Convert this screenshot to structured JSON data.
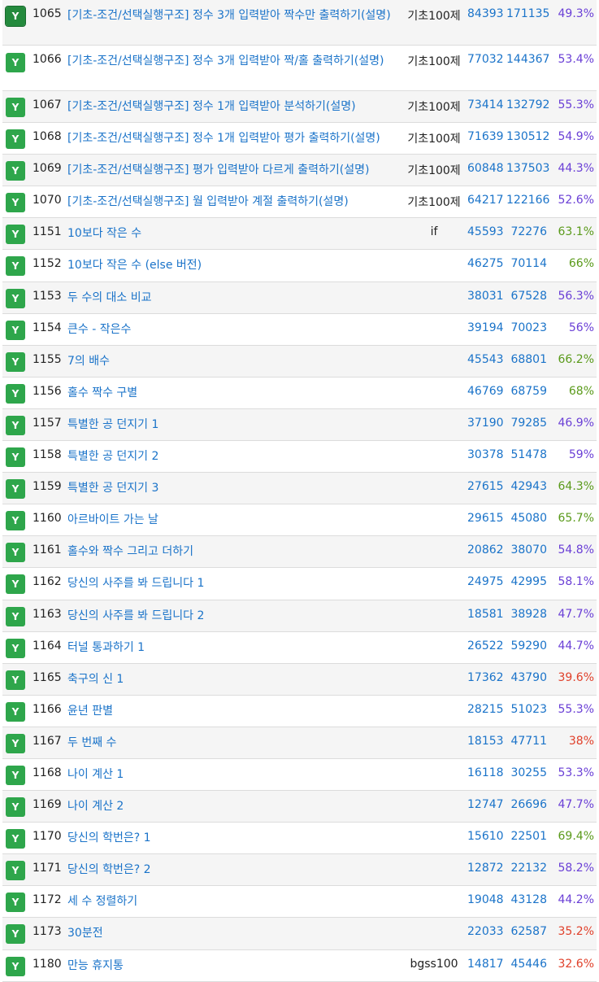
{
  "colors": {
    "badge": "#2ea64b",
    "link": "#1a73c9",
    "rate_purple": "#6a3fd6",
    "rate_green": "#5a9a1a",
    "rate_red": "#e0402a"
  },
  "badge_text": "Y",
  "rows": [
    {
      "id": "1065",
      "title": "[기초-조건/선택실행구조] 정수 3개 입력받아 짝수만 출력하기(설명)",
      "category": "기초100제",
      "solved": "84393",
      "submissions": "171135",
      "rate": "49.3%",
      "rate_color": "purple",
      "tall": true
    },
    {
      "id": "1066",
      "title": "[기초-조건/선택실행구조] 정수 3개 입력받아 짝/홀 출력하기(설명)",
      "category": "기초100제",
      "solved": "77032",
      "submissions": "144367",
      "rate": "53.4%",
      "rate_color": "purple",
      "tall": true
    },
    {
      "id": "1067",
      "title": "[기초-조건/선택실행구조] 정수 1개 입력받아 분석하기(설명)",
      "category": "기초100제",
      "solved": "73414",
      "submissions": "132792",
      "rate": "55.3%",
      "rate_color": "purple",
      "tall": false
    },
    {
      "id": "1068",
      "title": "[기초-조건/선택실행구조] 정수 1개 입력받아 평가 출력하기(설명)",
      "category": "기초100제",
      "solved": "71639",
      "submissions": "130512",
      "rate": "54.9%",
      "rate_color": "purple",
      "tall": false
    },
    {
      "id": "1069",
      "title": "[기초-조건/선택실행구조] 평가 입력받아 다르게 출력하기(설명)",
      "category": "기초100제",
      "solved": "60848",
      "submissions": "137503",
      "rate": "44.3%",
      "rate_color": "purple",
      "tall": false
    },
    {
      "id": "1070",
      "title": "[기초-조건/선택실행구조] 월 입력받아 계절 출력하기(설명)",
      "category": "기초100제",
      "solved": "64217",
      "submissions": "122166",
      "rate": "52.6%",
      "rate_color": "purple",
      "tall": false
    },
    {
      "id": "1151",
      "title": "10보다 작은 수",
      "category": "if",
      "solved": "45593",
      "submissions": "72276",
      "rate": "63.1%",
      "rate_color": "green",
      "tall": false
    },
    {
      "id": "1152",
      "title": "10보다 작은 수 (else 버전)",
      "category": "",
      "solved": "46275",
      "submissions": "70114",
      "rate": "66%",
      "rate_color": "green",
      "tall": false
    },
    {
      "id": "1153",
      "title": "두 수의 대소 비교",
      "category": "",
      "solved": "38031",
      "submissions": "67528",
      "rate": "56.3%",
      "rate_color": "purple",
      "tall": false
    },
    {
      "id": "1154",
      "title": "큰수 - 작은수",
      "category": "",
      "solved": "39194",
      "submissions": "70023",
      "rate": "56%",
      "rate_color": "purple",
      "tall": false
    },
    {
      "id": "1155",
      "title": "7의 배수",
      "category": "",
      "solved": "45543",
      "submissions": "68801",
      "rate": "66.2%",
      "rate_color": "green",
      "tall": false
    },
    {
      "id": "1156",
      "title": "홀수 짝수 구별",
      "category": "",
      "solved": "46769",
      "submissions": "68759",
      "rate": "68%",
      "rate_color": "green",
      "tall": false
    },
    {
      "id": "1157",
      "title": "특별한 공 던지기 1",
      "category": "",
      "solved": "37190",
      "submissions": "79285",
      "rate": "46.9%",
      "rate_color": "purple",
      "tall": false
    },
    {
      "id": "1158",
      "title": "특별한 공 던지기 2",
      "category": "",
      "solved": "30378",
      "submissions": "51478",
      "rate": "59%",
      "rate_color": "purple",
      "tall": false
    },
    {
      "id": "1159",
      "title": "특별한 공 던지기 3",
      "category": "",
      "solved": "27615",
      "submissions": "42943",
      "rate": "64.3%",
      "rate_color": "green",
      "tall": false
    },
    {
      "id": "1160",
      "title": "아르바이트 가는 날",
      "category": "",
      "solved": "29615",
      "submissions": "45080",
      "rate": "65.7%",
      "rate_color": "green",
      "tall": false
    },
    {
      "id": "1161",
      "title": "홀수와 짝수 그리고 더하기",
      "category": "",
      "solved": "20862",
      "submissions": "38070",
      "rate": "54.8%",
      "rate_color": "purple",
      "tall": false
    },
    {
      "id": "1162",
      "title": "당신의 사주를 봐 드립니다 1",
      "category": "",
      "solved": "24975",
      "submissions": "42995",
      "rate": "58.1%",
      "rate_color": "purple",
      "tall": false
    },
    {
      "id": "1163",
      "title": "당신의 사주를 봐 드립니다 2",
      "category": "",
      "solved": "18581",
      "submissions": "38928",
      "rate": "47.7%",
      "rate_color": "purple",
      "tall": false
    },
    {
      "id": "1164",
      "title": "터널 통과하기 1",
      "category": "",
      "solved": "26522",
      "submissions": "59290",
      "rate": "44.7%",
      "rate_color": "purple",
      "tall": false
    },
    {
      "id": "1165",
      "title": "축구의 신 1",
      "category": "",
      "solved": "17362",
      "submissions": "43790",
      "rate": "39.6%",
      "rate_color": "red",
      "tall": false
    },
    {
      "id": "1166",
      "title": "윤년 판별",
      "category": "",
      "solved": "28215",
      "submissions": "51023",
      "rate": "55.3%",
      "rate_color": "purple",
      "tall": false
    },
    {
      "id": "1167",
      "title": "두 번째 수",
      "category": "",
      "solved": "18153",
      "submissions": "47711",
      "rate": "38%",
      "rate_color": "red",
      "tall": false
    },
    {
      "id": "1168",
      "title": "나이 계산 1",
      "category": "",
      "solved": "16118",
      "submissions": "30255",
      "rate": "53.3%",
      "rate_color": "purple",
      "tall": false
    },
    {
      "id": "1169",
      "title": "나이 계산 2",
      "category": "",
      "solved": "12747",
      "submissions": "26696",
      "rate": "47.7%",
      "rate_color": "purple",
      "tall": false
    },
    {
      "id": "1170",
      "title": "당신의 학번은? 1",
      "category": "",
      "solved": "15610",
      "submissions": "22501",
      "rate": "69.4%",
      "rate_color": "green",
      "tall": false
    },
    {
      "id": "1171",
      "title": "당신의 학번은? 2",
      "category": "",
      "solved": "12872",
      "submissions": "22132",
      "rate": "58.2%",
      "rate_color": "purple",
      "tall": false
    },
    {
      "id": "1172",
      "title": "세 수 정렬하기",
      "category": "",
      "solved": "19048",
      "submissions": "43128",
      "rate": "44.2%",
      "rate_color": "purple",
      "tall": false
    },
    {
      "id": "1173",
      "title": "30분전",
      "category": "",
      "solved": "22033",
      "submissions": "62587",
      "rate": "35.2%",
      "rate_color": "red",
      "tall": false
    },
    {
      "id": "1180",
      "title": "만능 휴지통",
      "category": "bgss100",
      "solved": "14817",
      "submissions": "45446",
      "rate": "32.6%",
      "rate_color": "red",
      "tall": false
    }
  ]
}
